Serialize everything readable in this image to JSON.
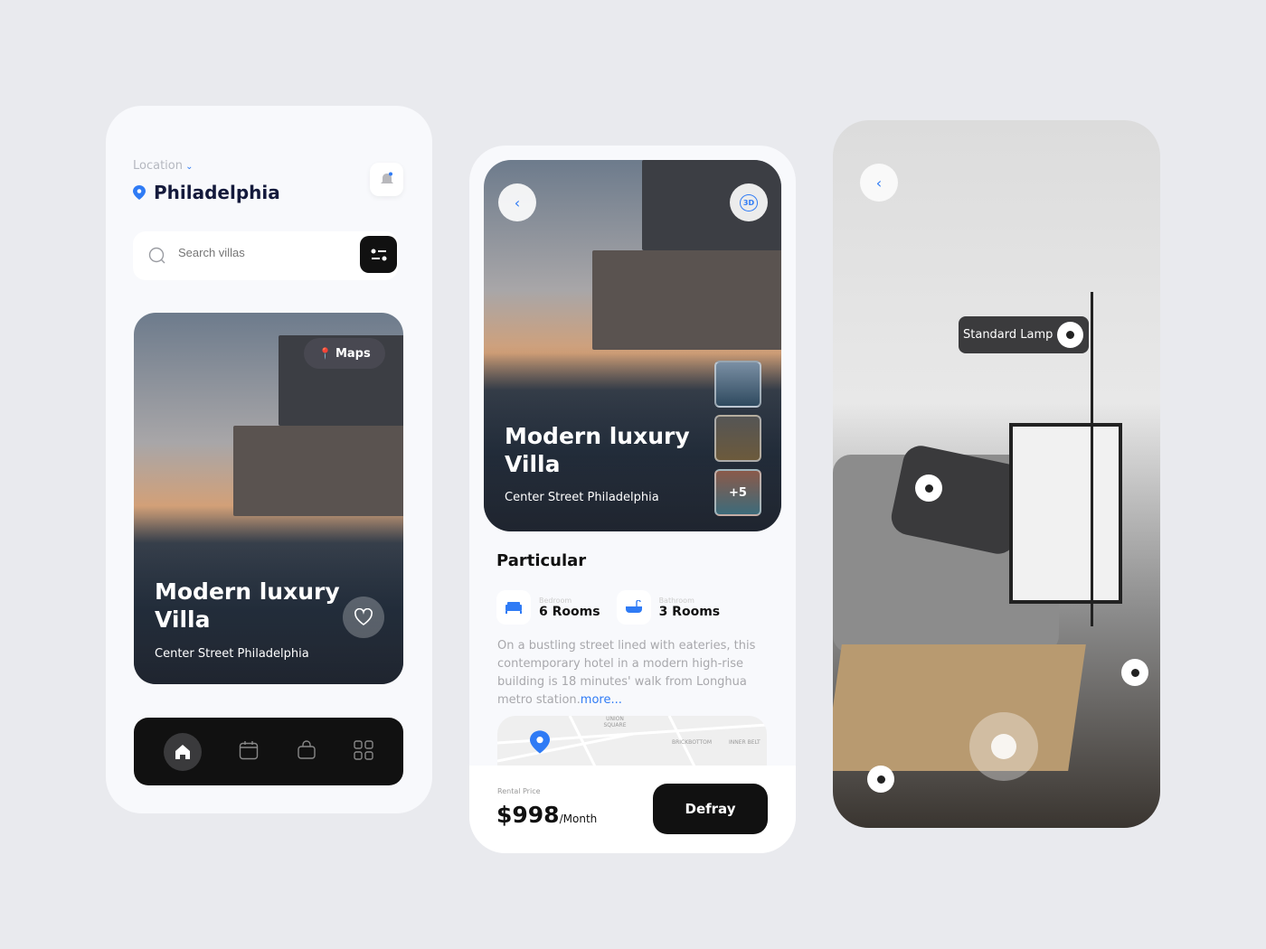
{
  "home": {
    "location_label": "Location",
    "city": "Philadelphia",
    "search_placeholder": "Search villas",
    "card": {
      "maps_label": "Maps",
      "title_line1": "Modern luxury",
      "title_line2": "Villa",
      "address": "Center Street Philadelphia"
    },
    "nav": [
      {
        "icon": "home-icon",
        "active": true
      },
      {
        "icon": "calendar-icon"
      },
      {
        "icon": "bag-icon"
      },
      {
        "icon": "grid-icon"
      }
    ]
  },
  "detail": {
    "title_line1": "Modern luxury",
    "title_line2": "Villa",
    "address": "Center Street Philadelphia",
    "badge_3d": "3D",
    "thumb_more": "+5",
    "section_title": "Particular",
    "features": [
      {
        "icon": "bed-icon",
        "label": "Bedroom",
        "value": "6 Rooms"
      },
      {
        "icon": "bathtub-icon",
        "label": "Bathroom",
        "value": "3 Rooms"
      }
    ],
    "description": "On a bustling street lined with eateries, this contemporary hotel in a modern high-rise building is 18 minutes' walk from Longhua metro station.",
    "more_link": "more...",
    "map_labels": [
      "UNION SQUARE",
      "BRICKBOTTOM",
      "INNER BELT"
    ],
    "price_label": "Rental Price",
    "price": "$998",
    "price_unit": "/Month",
    "cta": "Defray"
  },
  "ar": {
    "tag": "Standard Lamp"
  },
  "colors": {
    "accent": "#2f7bf5",
    "dark": "#111111",
    "navy": "#141a3c"
  }
}
